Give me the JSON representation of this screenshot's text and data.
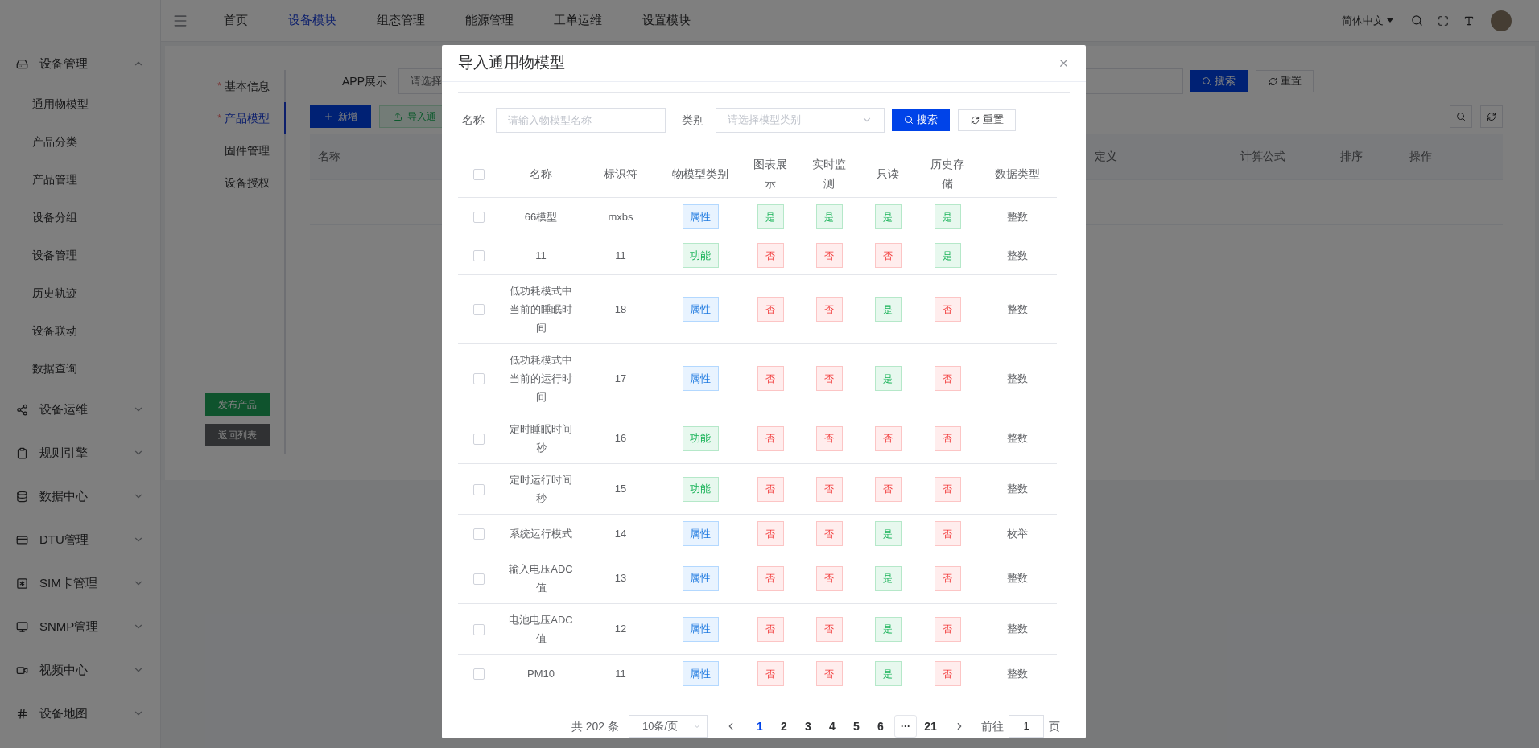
{
  "sidebar": {
    "items": [
      {
        "label": "设备管理",
        "expanded": true,
        "children": [
          {
            "label": "通用物模型"
          },
          {
            "label": "产品分类"
          },
          {
            "label": "产品管理"
          },
          {
            "label": "设备分组"
          },
          {
            "label": "设备管理"
          },
          {
            "label": "历史轨迹"
          },
          {
            "label": "设备联动"
          },
          {
            "label": "数据查询"
          }
        ]
      },
      {
        "label": "设备运维",
        "expanded": false
      },
      {
        "label": "规则引擎",
        "expanded": false
      },
      {
        "label": "数据中心",
        "expanded": false
      },
      {
        "label": "DTU管理",
        "expanded": false
      },
      {
        "label": "SIM卡管理",
        "expanded": false
      },
      {
        "label": "SNMP管理",
        "expanded": false
      },
      {
        "label": "视频中心",
        "expanded": false
      },
      {
        "label": "设备地图",
        "expanded": false
      }
    ]
  },
  "top_nav": {
    "items": [
      {
        "label": "首页",
        "selected": false
      },
      {
        "label": "设备模块",
        "selected": true
      },
      {
        "label": "组态管理",
        "selected": false
      },
      {
        "label": "能源管理",
        "selected": false
      },
      {
        "label": "工单运维",
        "selected": false
      },
      {
        "label": "设置模块",
        "selected": false
      }
    ],
    "language": "简体中文"
  },
  "product_tabs": [
    {
      "label": "基本信息",
      "required_mark": "*",
      "selected": false
    },
    {
      "label": "产品模型",
      "required_mark": "*",
      "selected": true
    },
    {
      "label": "固件管理",
      "selected": false
    },
    {
      "label": "设备授权",
      "selected": false
    }
  ],
  "product_actions": [
    {
      "label": "发布产品",
      "kind": "primary"
    },
    {
      "label": "返回列表",
      "kind": "secondary"
    }
  ],
  "filter": {
    "label": "APP展示",
    "placeholder": "请选择",
    "search": "搜索",
    "reset": "重置"
  },
  "toolbar": {
    "add": "新增",
    "import": "导入通"
  },
  "table": {
    "columns": [
      "名称",
      "定义",
      "计算公式",
      "排序",
      "操作"
    ]
  },
  "dialog": {
    "title": "导入通用物模型",
    "filters": [
      {
        "label": "名称",
        "kind": "input",
        "placeholder": "请输入物模型名称"
      },
      {
        "label": "类别",
        "kind": "select",
        "placeholder": "请选择模型类别"
      }
    ],
    "search": "搜索",
    "reset": "重置",
    "all_checked": false,
    "columns": [
      "名称",
      "标识符",
      "物模型类别",
      "图表展示",
      "实时监测",
      "只读",
      "历史存储",
      "数据类型"
    ],
    "rows": [
      {
        "checked": false,
        "name": "66模型",
        "identifier": "mxbs",
        "category": {
          "label": "属性",
          "kind": "property"
        },
        "flags": [
          {
            "label": "是",
            "on": true
          },
          {
            "label": "是",
            "on": true
          },
          {
            "label": "是",
            "on": true
          },
          {
            "label": "是",
            "on": true
          }
        ],
        "data_type": "整数"
      },
      {
        "checked": false,
        "name": "11",
        "identifier": "11",
        "category": {
          "label": "功能",
          "kind": "function"
        },
        "flags": [
          {
            "label": "否",
            "on": false
          },
          {
            "label": "否",
            "on": false
          },
          {
            "label": "否",
            "on": false
          },
          {
            "label": "是",
            "on": true
          }
        ],
        "data_type": "整数"
      },
      {
        "checked": false,
        "name": "低功耗模式中当前的睡眠时间",
        "identifier": "18",
        "category": {
          "label": "属性",
          "kind": "property"
        },
        "flags": [
          {
            "label": "否",
            "on": false
          },
          {
            "label": "否",
            "on": false
          },
          {
            "label": "是",
            "on": true
          },
          {
            "label": "否",
            "on": false
          }
        ],
        "data_type": "整数"
      },
      {
        "checked": false,
        "name": "低功耗模式中当前的运行时间",
        "identifier": "17",
        "category": {
          "label": "属性",
          "kind": "property"
        },
        "flags": [
          {
            "label": "否",
            "on": false
          },
          {
            "label": "否",
            "on": false
          },
          {
            "label": "是",
            "on": true
          },
          {
            "label": "否",
            "on": false
          }
        ],
        "data_type": "整数"
      },
      {
        "checked": false,
        "name": "定时睡眠时间秒",
        "identifier": "16",
        "category": {
          "label": "功能",
          "kind": "function"
        },
        "flags": [
          {
            "label": "否",
            "on": false
          },
          {
            "label": "否",
            "on": false
          },
          {
            "label": "否",
            "on": false
          },
          {
            "label": "否",
            "on": false
          }
        ],
        "data_type": "整数"
      },
      {
        "checked": false,
        "name": "定时运行时间秒",
        "identifier": "15",
        "category": {
          "label": "功能",
          "kind": "function"
        },
        "flags": [
          {
            "label": "否",
            "on": false
          },
          {
            "label": "否",
            "on": false
          },
          {
            "label": "否",
            "on": false
          },
          {
            "label": "否",
            "on": false
          }
        ],
        "data_type": "整数"
      },
      {
        "checked": false,
        "name": "系统运行模式",
        "identifier": "14",
        "category": {
          "label": "属性",
          "kind": "property"
        },
        "flags": [
          {
            "label": "否",
            "on": false
          },
          {
            "label": "否",
            "on": false
          },
          {
            "label": "是",
            "on": true
          },
          {
            "label": "否",
            "on": false
          }
        ],
        "data_type": "枚举"
      },
      {
        "checked": false,
        "name": "输入电压ADC值",
        "identifier": "13",
        "category": {
          "label": "属性",
          "kind": "property"
        },
        "flags": [
          {
            "label": "否",
            "on": false
          },
          {
            "label": "否",
            "on": false
          },
          {
            "label": "是",
            "on": true
          },
          {
            "label": "否",
            "on": false
          }
        ],
        "data_type": "整数"
      },
      {
        "checked": false,
        "name": "电池电压ADC值",
        "identifier": "12",
        "category": {
          "label": "属性",
          "kind": "property"
        },
        "flags": [
          {
            "label": "否",
            "on": false
          },
          {
            "label": "否",
            "on": false
          },
          {
            "label": "是",
            "on": true
          },
          {
            "label": "否",
            "on": false
          }
        ],
        "data_type": "整数"
      },
      {
        "checked": false,
        "name": "PM10",
        "identifier": "11",
        "category": {
          "label": "属性",
          "kind": "property"
        },
        "flags": [
          {
            "label": "否",
            "on": false
          },
          {
            "label": "否",
            "on": false
          },
          {
            "label": "是",
            "on": true
          },
          {
            "label": "否",
            "on": false
          }
        ],
        "data_type": "整数"
      }
    ],
    "pagination": {
      "total": "共 202 条",
      "page_size": "10条/页",
      "pages": [
        {
          "label": "1",
          "kind": "page",
          "selected": true
        },
        {
          "label": "2",
          "kind": "page",
          "selected": false
        },
        {
          "label": "3",
          "kind": "page",
          "selected": false
        },
        {
          "label": "4",
          "kind": "page",
          "selected": false
        },
        {
          "label": "5",
          "kind": "page",
          "selected": false
        },
        {
          "label": "6",
          "kind": "page",
          "selected": false
        },
        {
          "label": "···",
          "kind": "more",
          "selected": false
        },
        {
          "label": "21",
          "kind": "page",
          "selected": false
        }
      ],
      "goto_label": "前往",
      "goto_value": "1",
      "goto_suffix": "页"
    }
  }
}
